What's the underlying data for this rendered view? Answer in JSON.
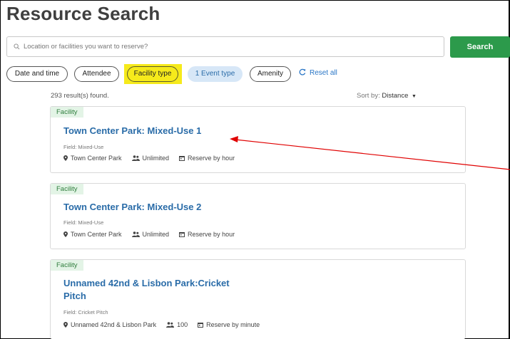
{
  "page": {
    "title": "Resource Search"
  },
  "search": {
    "placeholder": "Location or facilities you want to reserve?",
    "button_label": "Search"
  },
  "filters": {
    "date_time": "Date and time",
    "attendee": "Attendee",
    "facility_type": "Facility type",
    "event_type": "1 Event type",
    "amenity": "Amenity",
    "reset": "Reset all"
  },
  "results": {
    "count_text": "293 result(s) found.",
    "sort_label": "Sort by:",
    "sort_value": "Distance",
    "items": [
      {
        "tag": "Facility",
        "title": "Town Center Park: Mixed-Use 1",
        "field": "Field: Mixed-Use",
        "location": "Town Center Park",
        "capacity": "Unlimited",
        "reserve": "Reserve by hour"
      },
      {
        "tag": "Facility",
        "title": "Town Center Park: Mixed-Use 2",
        "field": "Field: Mixed-Use",
        "location": "Town Center Park",
        "capacity": "Unlimited",
        "reserve": "Reserve by hour"
      },
      {
        "tag": "Facility",
        "title_line1": "Unnamed 42nd & Lisbon Park:Cricket",
        "title_line2": "Pitch",
        "field": "Field: Cricket Pitch",
        "location": "Unnamed 42nd & Lisbon Park",
        "capacity": "100",
        "reserve": "Reserve by minute"
      }
    ]
  },
  "colors": {
    "accent_green": "#2c9a4b",
    "link_blue": "#2a6ca8",
    "highlight_yellow": "#f6ea1b",
    "annotation_red": "#e00000"
  }
}
